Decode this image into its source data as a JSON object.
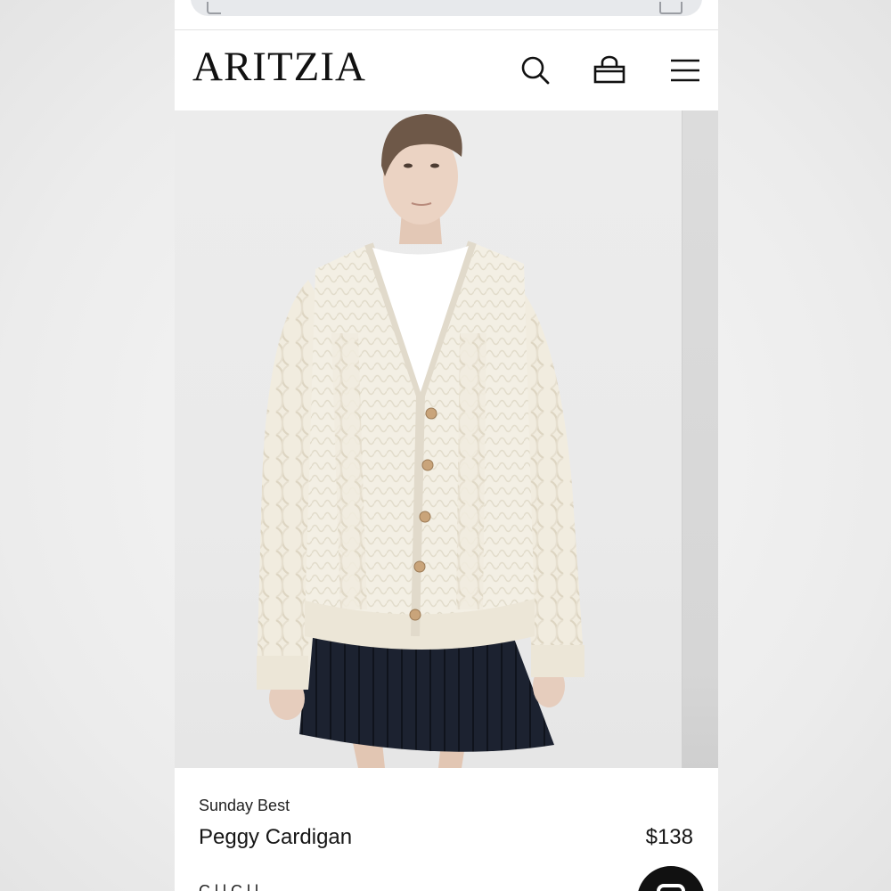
{
  "browser": {
    "url_bar": ""
  },
  "header": {
    "logo": "ARITZIA",
    "icons": {
      "search": "search-icon",
      "bag": "shopping-bag-icon",
      "menu": "hamburger-menu-icon"
    }
  },
  "product": {
    "brand": "Sunday Best",
    "name": "Peggy Cardigan",
    "price": "$138",
    "next_line_partial": "C l l   C l l"
  },
  "colors": {
    "cardigan": "#f3efe4",
    "skirt": "#1c2230",
    "accent": "#111111"
  }
}
